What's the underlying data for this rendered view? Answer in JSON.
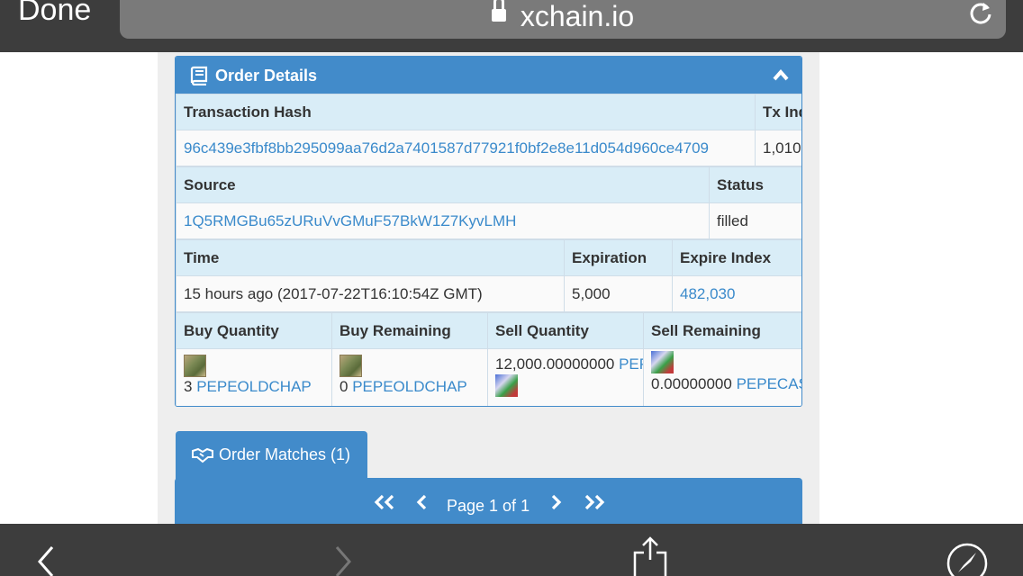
{
  "browser": {
    "done_label": "Done",
    "url": "xchain.io"
  },
  "order_details": {
    "title": "Order Details",
    "headers1": [
      "Transaction Hash",
      "Tx Index"
    ],
    "tx_hash": "96c439e3fbf8bb295099aa76d2a7401587d77921f0bf2e8e11d054d960ce4709",
    "tx_index": "1,010",
    "headers2": [
      "Source",
      "Status"
    ],
    "source": "1Q5RMGBu65zURuVvGMuF57BkW1Z7KyvLMH",
    "status": "filled",
    "headers3": [
      "Time",
      "Expiration",
      "Expire Index"
    ],
    "time": "15 hours ago (2017-07-22T16:10:54Z GMT)",
    "expiration": "5,000",
    "expire_index": "482,030",
    "headers4": [
      "Buy Quantity",
      "Buy Remaining",
      "Sell Quantity",
      "Sell Remaining"
    ],
    "buy_quantity_amount": "3",
    "buy_quantity_asset": "PEPEOLDCHAP",
    "buy_remaining_amount": "0",
    "buy_remaining_asset": "PEPEOLDCHAP",
    "sell_quantity_amount": "12,000.00000000",
    "sell_quantity_asset": "PEPECASH",
    "sell_remaining_amount": "0.00000000",
    "sell_remaining_asset": "PEPECASH"
  },
  "order_matches": {
    "tab_label": "Order Matches (1)",
    "page_label": "Page 1 of 1"
  },
  "icons": [
    "lock-icon",
    "reload-icon",
    "book-icon",
    "chevron-up-icon",
    "handshake-icon",
    "first-page-icon",
    "prev-page-icon",
    "next-page-icon",
    "last-page-icon",
    "back-icon",
    "forward-icon",
    "share-icon",
    "compass-icon"
  ]
}
